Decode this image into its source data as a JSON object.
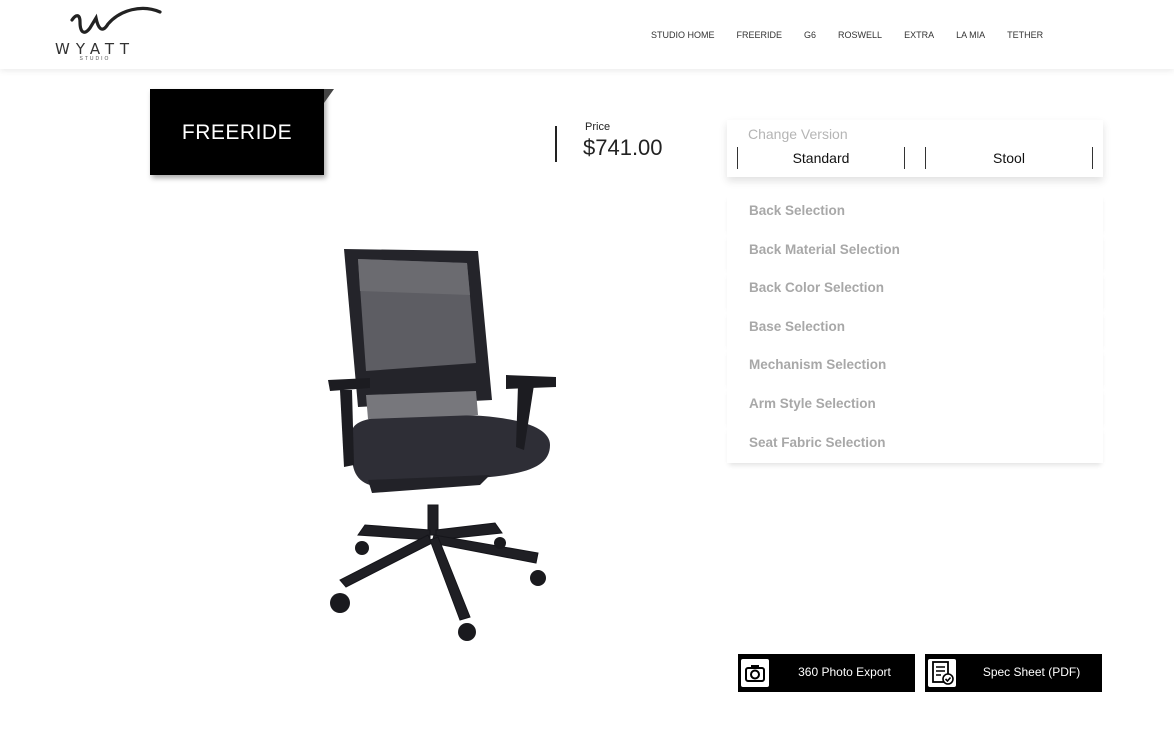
{
  "brand": {
    "name": "WYATT",
    "sub": "STUDIO"
  },
  "nav": {
    "items": [
      "STUDIO HOME",
      "FREERIDE",
      "G6",
      "ROSWELL",
      "EXTRA",
      "LA MIA",
      "TETHER"
    ]
  },
  "product": {
    "title": "FREERIDE",
    "price_label": "Price",
    "price_value": "$741.00"
  },
  "version": {
    "title": "Change Version",
    "options": [
      "Standard",
      "Stool"
    ]
  },
  "selections": [
    "Back Selection",
    "Back Material Selection",
    "Back Color Selection",
    "Base Selection",
    "Mechanism Selection",
    "Arm Style Selection",
    "Seat Fabric Selection"
  ],
  "actions": {
    "photo_export": "360 Photo Export",
    "spec_sheet": "Spec Sheet (PDF)"
  },
  "icons": {
    "photo": "camera-icon",
    "spec": "document-check-icon"
  },
  "colors": {
    "accent": "#000000",
    "muted_text": "#a8a8a8"
  }
}
